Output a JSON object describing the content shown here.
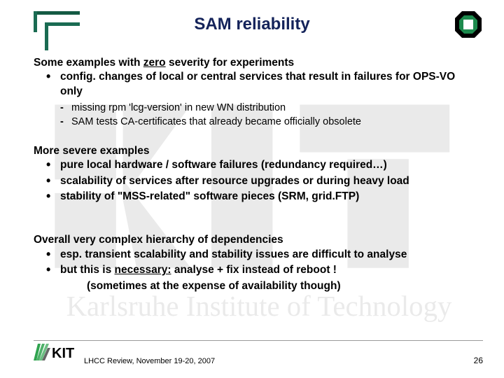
{
  "title": "SAM reliability",
  "section1": {
    "lead_prefix": "Some examples with ",
    "lead_underlined": "zero",
    "lead_suffix": " severity for experiments",
    "bullets": [
      "config. changes of local or central services that result in failures for OPS-VO only"
    ],
    "dashes": [
      "missing rpm 'lcg-version' in new WN distribution",
      "SAM tests CA-certificates that already became officially obsolete"
    ]
  },
  "section2": {
    "lead": "More severe examples",
    "bullets": [
      "pure local hardware / software failures (redundancy required…)",
      "scalability of services after resource upgrades or during heavy load",
      "stability of \"MSS-related\" software pieces (SRM, grid.FTP)"
    ]
  },
  "section3": {
    "lead": "Overall very complex hierarchy of dependencies",
    "bullet1": "esp. transient scalability and stability issues are difficult to analyse",
    "bullet2_prefix": "but this is ",
    "bullet2_underlined": "necessary:",
    "bullet2_suffix": "   analyse + fix instead of reboot !",
    "note": "(sometimes at the expense of availability though)"
  },
  "footer": {
    "text": "LHCC Review, November 19-20, 2007",
    "page": "26"
  }
}
